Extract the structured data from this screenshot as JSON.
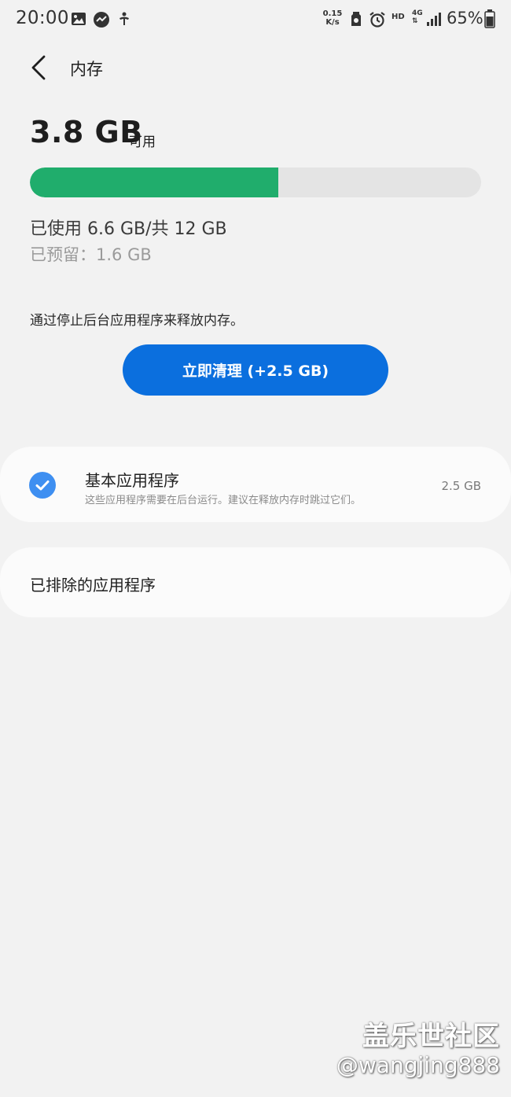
{
  "status_bar": {
    "time": "20:00",
    "net_speed_value": "0.15",
    "net_speed_unit": "K/s",
    "hd": "HD",
    "network": "4G",
    "battery": "65%",
    "icons": [
      "gallery-icon",
      "recorder-icon",
      "accessibility-icon",
      "nfc-icon",
      "alarm-icon",
      "signal-icon",
      "battery-icon"
    ]
  },
  "header": {
    "back_icon": "chevron-left-icon",
    "title": "内存"
  },
  "memory": {
    "available_value": "3.8 GB",
    "available_label": "可用",
    "used_fraction": 0.55,
    "used_text": "已使用 6.6 GB/共 12 GB",
    "reserved_text": "已预留：1.6 GB",
    "bar_used_color": "#20ad6c",
    "bar_track_color": "#e4e4e4"
  },
  "hint": "通过停止后台应用程序来释放内存。",
  "clean_button": {
    "label": "立即清理 (+2.5 GB)",
    "color": "#0b6fde"
  },
  "essential_apps": {
    "checked": true,
    "title": "基本应用程序",
    "description": "这些应用程序需要在后台运行。建议在释放内存时跳过它们。",
    "size": "2.5 GB"
  },
  "excluded_apps": {
    "title": "已排除的应用程序"
  },
  "watermark": {
    "site": "盖乐世社区",
    "user": "@wangjing888"
  }
}
